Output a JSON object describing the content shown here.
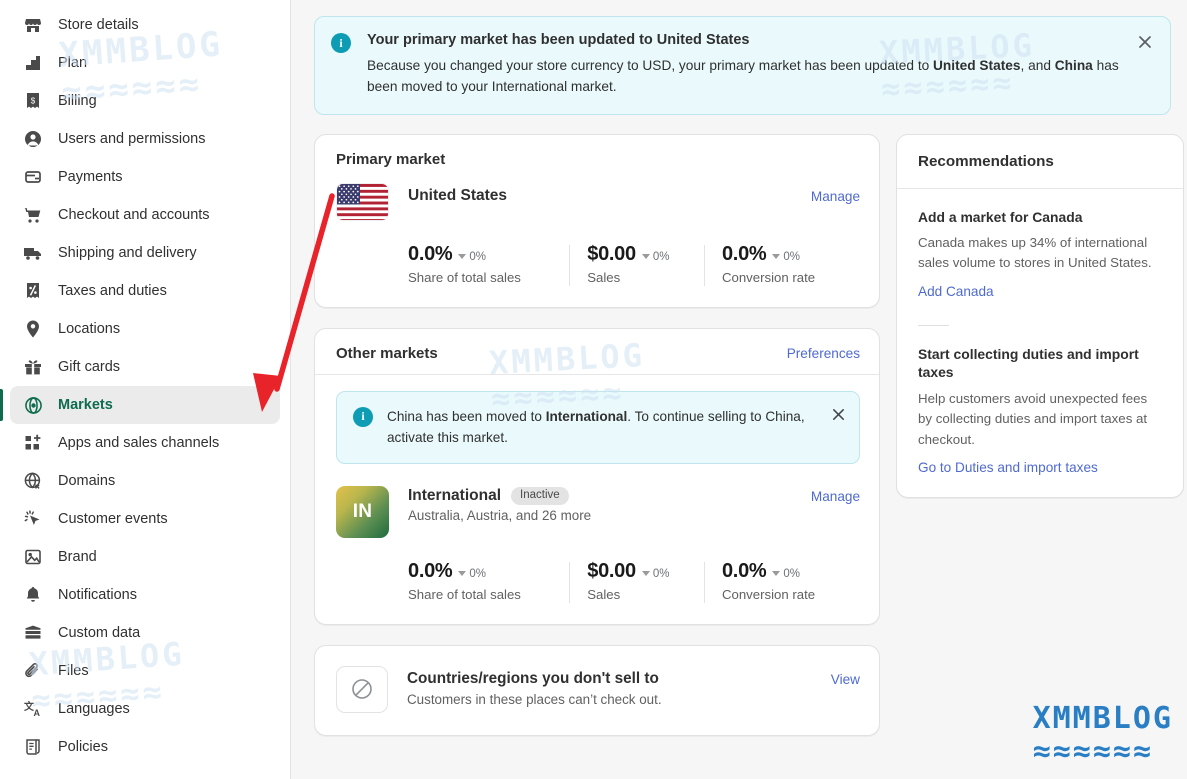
{
  "sidebar": {
    "items": [
      {
        "label": "Store details",
        "icon": "store-icon",
        "active": false
      },
      {
        "label": "Plan",
        "icon": "plan-icon",
        "active": false
      },
      {
        "label": "Billing",
        "icon": "billing-icon",
        "active": false
      },
      {
        "label": "Users and permissions",
        "icon": "user-icon",
        "active": false
      },
      {
        "label": "Payments",
        "icon": "payments-icon",
        "active": false
      },
      {
        "label": "Checkout and accounts",
        "icon": "cart-icon",
        "active": false
      },
      {
        "label": "Shipping and delivery",
        "icon": "truck-icon",
        "active": false
      },
      {
        "label": "Taxes and duties",
        "icon": "percent-icon",
        "active": false
      },
      {
        "label": "Locations",
        "icon": "pin-icon",
        "active": false
      },
      {
        "label": "Gift cards",
        "icon": "gift-icon",
        "active": false
      },
      {
        "label": "Markets",
        "icon": "globe-target-icon",
        "active": true
      },
      {
        "label": "Apps and sales channels",
        "icon": "apps-plus-icon",
        "active": false
      },
      {
        "label": "Domains",
        "icon": "globe-icon",
        "active": false
      },
      {
        "label": "Customer events",
        "icon": "cursor-click-icon",
        "active": false
      },
      {
        "label": "Brand",
        "icon": "image-icon",
        "active": false
      },
      {
        "label": "Notifications",
        "icon": "bell-icon",
        "active": false
      },
      {
        "label": "Custom data",
        "icon": "database-icon",
        "active": false
      },
      {
        "label": "Files",
        "icon": "paperclip-icon",
        "active": false
      },
      {
        "label": "Languages",
        "icon": "translate-icon",
        "active": false
      },
      {
        "label": "Policies",
        "icon": "scroll-icon",
        "active": false
      }
    ]
  },
  "banner": {
    "icon": "info-icon",
    "icon_glyph": "i",
    "title": "Your primary market has been updated to United States",
    "text_part1": "Because you changed your store currency to USD, your primary market has been updated to ",
    "text_bold1": "United States",
    "text_part2": ", and ",
    "text_bold2": "China",
    "text_part3": " has been moved to your International market.",
    "close_label": "×",
    "accent_color": "#0e9cb5",
    "background_color": "#eafafc"
  },
  "primary_market": {
    "card_title": "Primary market",
    "country": "United States",
    "flag": "us-flag-icon",
    "manage_label": "Manage",
    "metrics": [
      {
        "value": "0.0%",
        "delta": "0%",
        "label": "Share of total sales"
      },
      {
        "value": "$0.00",
        "delta": "0%",
        "label": "Sales"
      },
      {
        "value": "0.0%",
        "delta": "0%",
        "label": "Conversion rate"
      }
    ]
  },
  "other_markets": {
    "card_title": "Other markets",
    "preferences_label": "Preferences",
    "notice": {
      "icon": "info-icon",
      "icon_glyph": "i",
      "text_part1": "China has been moved to ",
      "text_bold": "International",
      "text_part2": ". To continue selling to China, activate this market.",
      "close_label": "×"
    },
    "market": {
      "avatar_initials": "IN",
      "name": "International",
      "badge": "Inactive",
      "subtitle": "Australia, Austria, and 26 more",
      "manage_label": "Manage",
      "metrics": [
        {
          "value": "0.0%",
          "delta": "0%",
          "label": "Share of total sales"
        },
        {
          "value": "$0.00",
          "delta": "0%",
          "label": "Sales"
        },
        {
          "value": "0.0%",
          "delta": "0%",
          "label": "Conversion rate"
        }
      ]
    }
  },
  "no_sell_card": {
    "icon": "prohibited-icon",
    "title": "Countries/regions you don't sell to",
    "subtitle": "Customers in these places can’t check out.",
    "view_label": "View"
  },
  "recommendations": {
    "title": "Recommendations",
    "items": [
      {
        "title": "Add a market for Canada",
        "text": "Canada makes up 34% of international sales volume to stores in United States.",
        "link": "Add Canada"
      },
      {
        "title": "Start collecting duties and import taxes",
        "text": "Help customers avoid unexpected fees by collecting duties and import taxes at checkout.",
        "link": "Go to Duties and import taxes"
      }
    ]
  },
  "watermark": {
    "text": "XMMBLOG",
    "wave": "≈≈≈≈≈≈",
    "color": "#2a7ec4"
  },
  "annotation": {
    "arrow": "red-arrow-annotation",
    "color": "#e8242a"
  }
}
